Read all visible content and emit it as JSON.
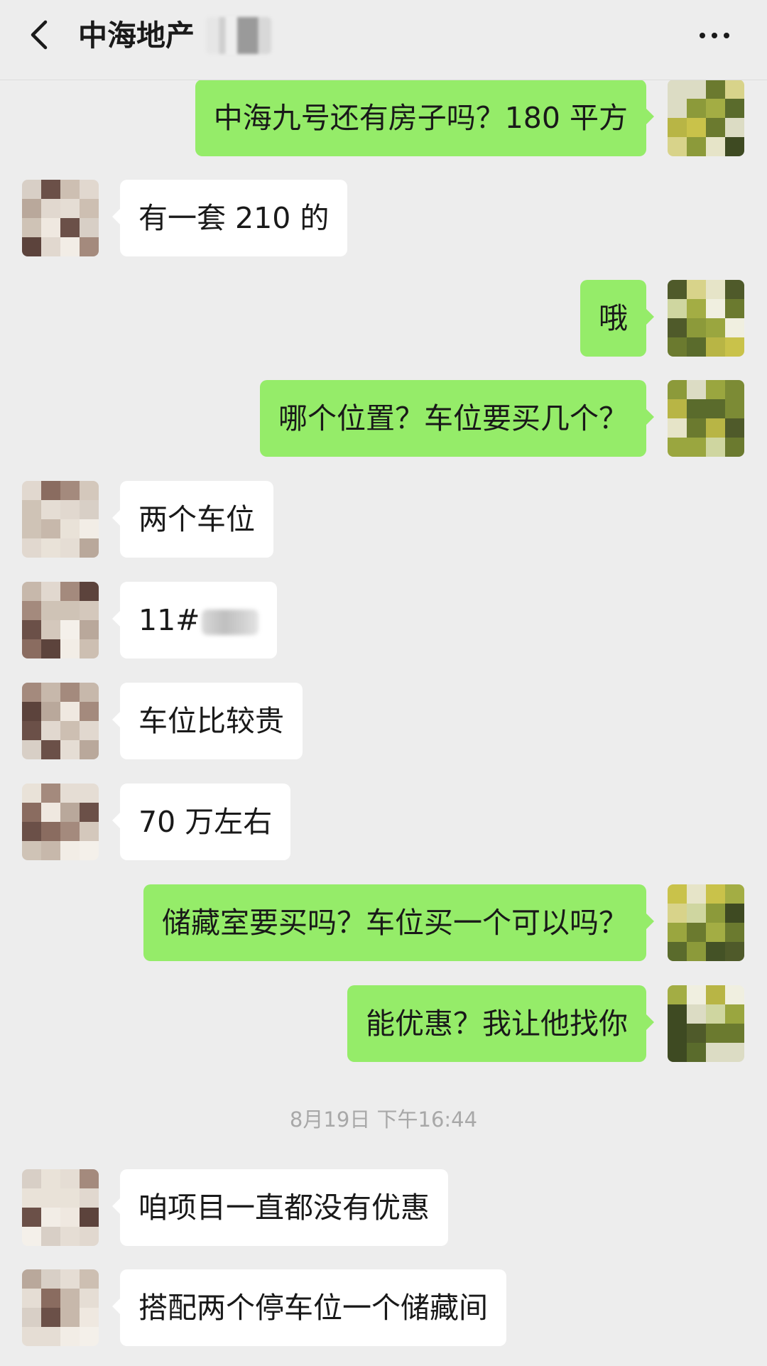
{
  "header": {
    "title": "中海地产",
    "back_icon": "chevron-left-icon",
    "more_icon": "more-dots-icon"
  },
  "colors": {
    "background": "#ededed",
    "sent_bubble": "#95ec69",
    "received_bubble": "#ffffff",
    "timestamp_text": "#a8a8a8"
  },
  "messages": [
    {
      "side": "right",
      "text": "中海九号还有房子吗？180 平方"
    },
    {
      "side": "left",
      "text": "有一套 210 的"
    },
    {
      "side": "right",
      "text": "哦"
    },
    {
      "side": "right",
      "text": "哪个位置？车位要买几个？"
    },
    {
      "side": "left",
      "text": "两个车位"
    },
    {
      "side": "left",
      "text": "11#",
      "redacted_suffix": true
    },
    {
      "side": "left",
      "text": "车位比较贵"
    },
    {
      "side": "left",
      "text": "70 万左右"
    },
    {
      "side": "right",
      "text": "储藏室要买吗？车位买一个可以吗？"
    },
    {
      "side": "right",
      "text": "能优惠？我让他找你"
    },
    {
      "side": "left",
      "text": "咱项目一直都没有优惠"
    },
    {
      "side": "left",
      "text": "搭配两个停车位一个储藏间"
    }
  ],
  "timestamp": "8月19日 下午16:44"
}
